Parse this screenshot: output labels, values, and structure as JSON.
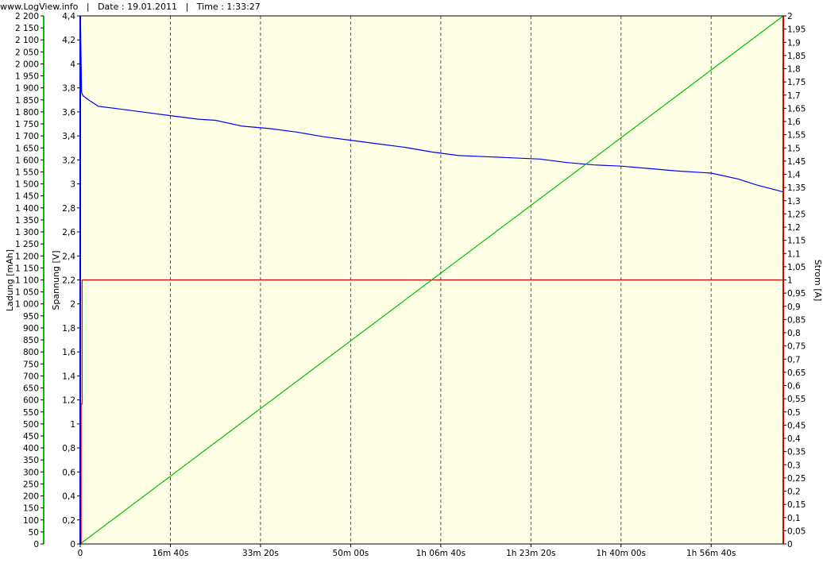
{
  "header": {
    "site": "www.LogView.info",
    "sep": "|",
    "date": "Date : 19.01.2011",
    "time": "Time : 1:33:27"
  },
  "chart_data": {
    "type": "line",
    "title": "",
    "x": {
      "unit": "seconds",
      "range": [
        0,
        7000
      ],
      "ticks": [
        0,
        1000,
        2000,
        3000,
        4000,
        5000,
        6000,
        7000
      ],
      "tick_labels": [
        "0",
        "16m 40s",
        "33m 20s",
        "50m 00s",
        "1h 06m 40s",
        "1h 23m 20s",
        "1h 40m 00s",
        "1h 56m 40s"
      ],
      "end": 7800
    },
    "axes": {
      "charge": {
        "label": "Ladung [mAh]",
        "range": [
          0,
          2200
        ],
        "color": "#00c000",
        "tick_labels": [
          "0",
          "50",
          "100",
          "150",
          "200",
          "250",
          "300",
          "350",
          "400",
          "450",
          "500",
          "550",
          "600",
          "650",
          "700",
          "750",
          "800",
          "850",
          "900",
          "950",
          "1 000",
          "1 050",
          "1 100",
          "1 150",
          "1 200",
          "1 250",
          "1 300",
          "1 350",
          "1 400",
          "1 450",
          "1 500",
          "1 550",
          "1 600",
          "1 650",
          "1 700",
          "1 750",
          "1 800",
          "1 850",
          "1 900",
          "1 950",
          "2 000",
          "2 050",
          "2 100",
          "2 150",
          "2 200"
        ]
      },
      "voltage": {
        "label": "Spannung [V]",
        "range": [
          0,
          4.5
        ],
        "color": "#0000ff",
        "tick_labels": [
          "0",
          "0,2",
          "0,4",
          "0,6",
          "0,8",
          "1",
          "1,2",
          "1,4",
          "1,6",
          "1,8",
          "2",
          "2,2",
          "2,4",
          "2,6",
          "2,8",
          "3",
          "3,2",
          "3,4",
          "3,6",
          "3,8",
          "4",
          "4,2",
          "4,4"
        ]
      },
      "current": {
        "label": "Strom [A]",
        "range": [
          0,
          2
        ],
        "color": "#dd0000",
        "tick_labels": [
          "0",
          "0,05",
          "0,1",
          "0,15",
          "0,2",
          "0,25",
          "0,3",
          "0,35",
          "0,4",
          "0,45",
          "0,5",
          "0,55",
          "0,6",
          "0,65",
          "0,7",
          "0,75",
          "0,8",
          "0,85",
          "0,9",
          "0,95",
          "1",
          "1,05",
          "1,1",
          "1,15",
          "1,2",
          "1,25",
          "1,3",
          "1,35",
          "1,4",
          "1,45",
          "1,5",
          "1,55",
          "1,6",
          "1,65",
          "1,7",
          "1,75",
          "1,8",
          "1,85",
          "1,9",
          "1,95",
          "2"
        ]
      }
    },
    "grid": "vertical dashed",
    "background": "#ffffe5",
    "series": [
      {
        "axis": "voltage",
        "color": "#0000ff",
        "points": [
          [
            0,
            0
          ],
          [
            3,
            4.5
          ],
          [
            8,
            4.2
          ],
          [
            15,
            3.85
          ],
          [
            30,
            3.82
          ],
          [
            100,
            3.78
          ],
          [
            200,
            3.73
          ],
          [
            400,
            3.71
          ],
          [
            600,
            3.69
          ],
          [
            800,
            3.67
          ],
          [
            1000,
            3.65
          ],
          [
            1300,
            3.62
          ],
          [
            1500,
            3.61
          ],
          [
            1800,
            3.56
          ],
          [
            2100,
            3.54
          ],
          [
            2400,
            3.51
          ],
          [
            2700,
            3.47
          ],
          [
            3000,
            3.44
          ],
          [
            3300,
            3.41
          ],
          [
            3600,
            3.38
          ],
          [
            3900,
            3.34
          ],
          [
            4200,
            3.31
          ],
          [
            4500,
            3.3
          ],
          [
            4800,
            3.29
          ],
          [
            5100,
            3.28
          ],
          [
            5400,
            3.25
          ],
          [
            5700,
            3.23
          ],
          [
            6000,
            3.22
          ],
          [
            6300,
            3.2
          ],
          [
            6600,
            3.18
          ],
          [
            7000,
            3.16
          ],
          [
            7300,
            3.11
          ],
          [
            7500,
            3.06
          ],
          [
            7800,
            3.0
          ]
        ]
      },
      {
        "axis": "current",
        "color": "#dd0000",
        "points": [
          [
            0,
            0
          ],
          [
            10,
            0
          ],
          [
            10,
            0.53
          ],
          [
            20,
            0.53
          ],
          [
            20,
            1.0
          ],
          [
            7800,
            1.0
          ]
        ]
      },
      {
        "axis": "charge",
        "color": "#00c000",
        "points": [
          [
            0,
            0
          ],
          [
            7800,
            2200
          ]
        ]
      }
    ]
  }
}
